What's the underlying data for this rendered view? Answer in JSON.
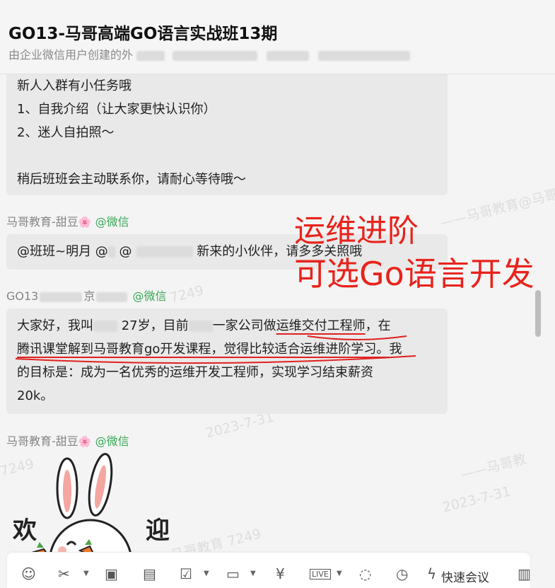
{
  "header": {
    "title": "GO13-马哥高端GO语言实战班13期",
    "subtitle_prefix": "由企业微信用户创建的外"
  },
  "messages": [
    {
      "lines": [
        "新人入群有小任务哦",
        "1、自我介绍（让大家更快认识你）",
        "2、迷人自拍照～",
        "",
        "稍后班班会主动联系你，请耐心等待哦～"
      ]
    },
    {
      "sender": "马哥教育-甜豆",
      "flower": "🌸",
      "wechat": "@微信",
      "text_a": "@班班~明月 @",
      "text_b": "@",
      "text_c": "新来的小伙伴，请多多关照哦"
    },
    {
      "sender": "GO13",
      "sender_tail": "京",
      "wechat": "@微信",
      "line1_a": "大家好，我叫",
      "line1_b": "27岁，目前",
      "line1_c": "一家公司做",
      "line1_d": "运维交付工程师",
      "line1_e": "，在",
      "line2": "腾讯课堂解到马哥教育go开发课程，觉得比较适合运维进阶学习。",
      "line2_tail": "我",
      "line3": "的目标是：成为一名优秀的运维开发工程师，实现学习结束薪资",
      "line4": "20k。"
    },
    {
      "sender": "马哥教育-甜豆",
      "flower": "🌸",
      "wechat": "@微信",
      "sticker": {
        "char1": "欢",
        "char2": "迎"
      }
    }
  ],
  "annotation": {
    "line1": "运维进阶",
    "line2": "可选Go语言开发",
    "color": "#e8231c"
  },
  "watermarks": {
    "w1": "——马哥教育@马哥",
    "w2": "2023-7-31",
    "w3": "7249",
    "w4": "马哥教育 7249",
    "w5": "2023-7-31",
    "w6": "7249",
    "w7": "——马哥教",
    "w8": "2023-7-31",
    "w9": "马哥教育 7249",
    "w10": "2023-"
  },
  "toolbar": {
    "quick_meeting": "快速会议",
    "icons": [
      "emoji-icon",
      "scissors-icon",
      "image-icon",
      "document-icon",
      "calendar-icon",
      "folder-icon",
      "money-icon",
      "live-icon",
      "chat-bubble-icon",
      "clock-icon",
      "lightning-icon",
      "more-icon"
    ]
  }
}
